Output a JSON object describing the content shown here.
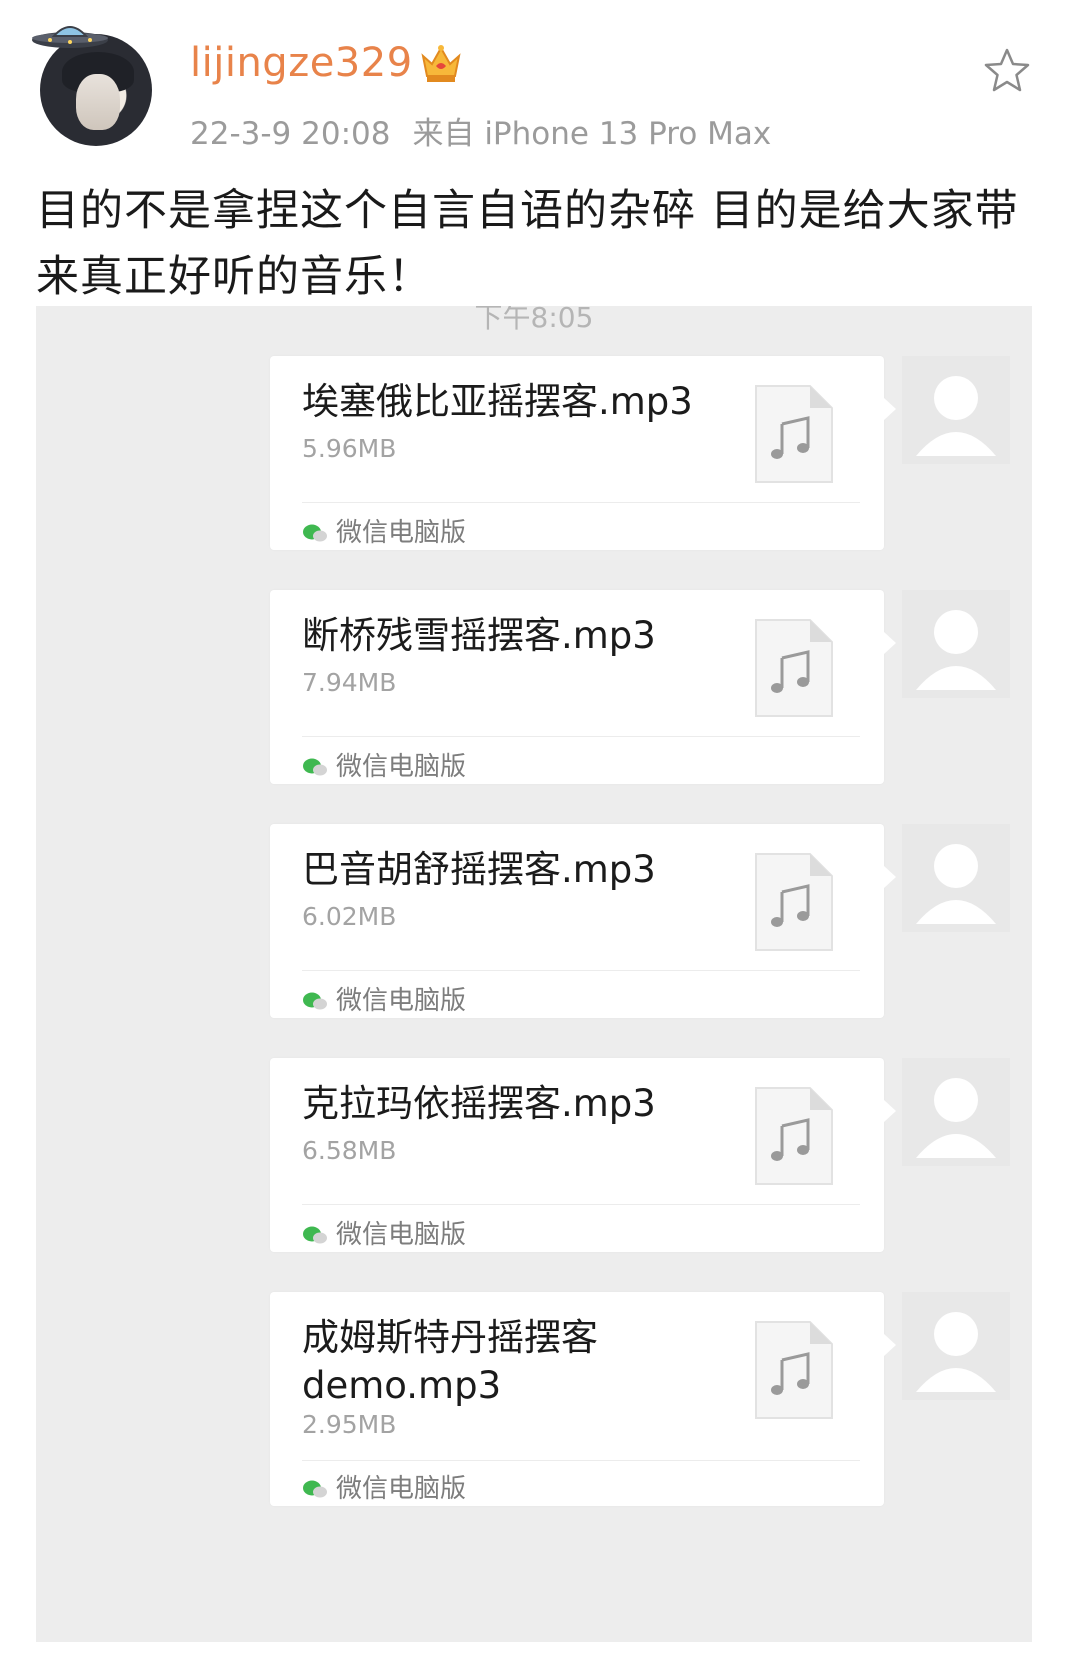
{
  "post": {
    "username": "lijingze329",
    "date": "22-3-9 20:08",
    "source": "来自 iPhone 13 Pro Max",
    "text": "目的不是拿捏这个自言自语的杂碎 目的是给大家带来真正好听的音乐！",
    "badge_icon": "crown-badge-icon",
    "favorite_icon": "star-icon"
  },
  "chat": {
    "time": "下午8:05",
    "messages": [
      {
        "file_name": "埃塞俄比亚摇摆客.mp3",
        "size": "5.96MB",
        "source": "微信电脑版"
      },
      {
        "file_name": "断桥残雪摇摆客.mp3",
        "size": "7.94MB",
        "source": "微信电脑版"
      },
      {
        "file_name": "巴音胡舒摇摆客.mp3",
        "size": "6.02MB",
        "source": "微信电脑版"
      },
      {
        "file_name": "克拉玛依摇摆客.mp3",
        "size": "6.58MB",
        "source": "微信电脑版"
      },
      {
        "file_name": "成姆斯特丹摇摆客demo.mp3",
        "size": "2.95MB",
        "source": "微信电脑版"
      }
    ]
  },
  "colors": {
    "username": "#e8834a",
    "meta": "#9b9b9b",
    "chat_bg": "#ededed",
    "wechat_green": "#3fb850"
  }
}
